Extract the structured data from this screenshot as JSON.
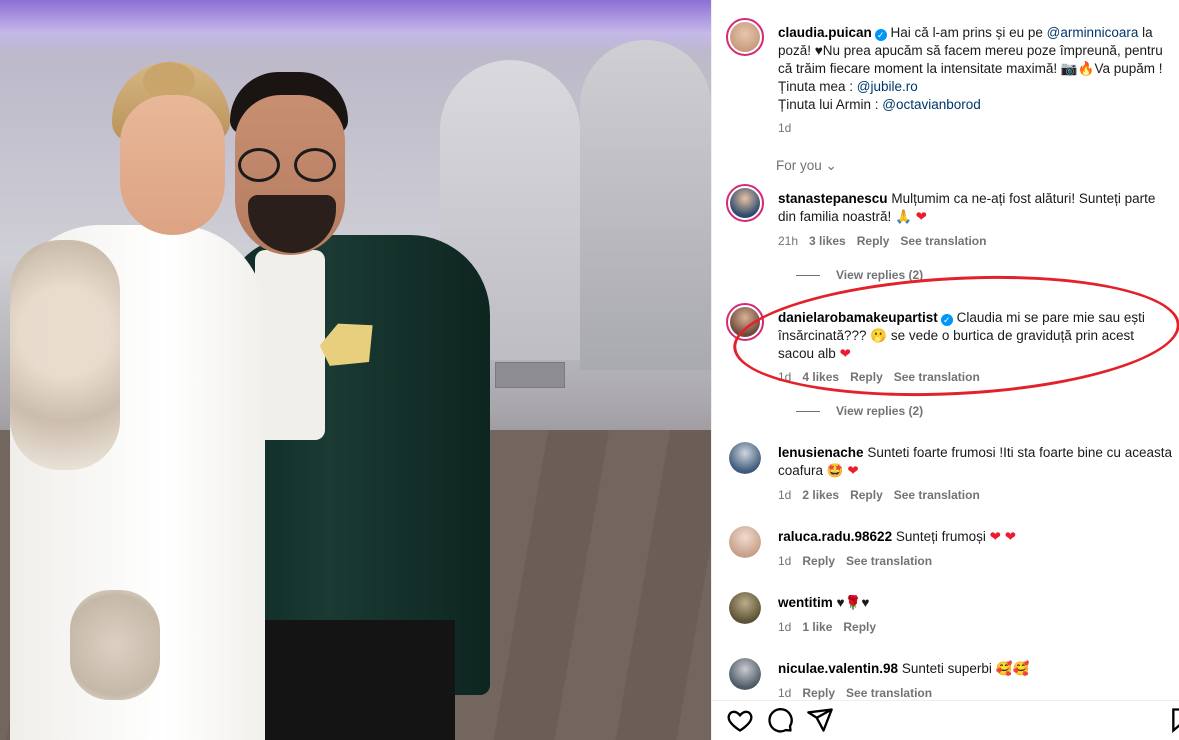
{
  "post": {
    "author": "claudia.puican",
    "caption_parts": {
      "p1": "Hai că l-am prins și eu pe ",
      "mention1": "@arminnicoara",
      "p2": " la poză! ♥Nu prea apucăm să facem mereu poze împreună, pentru că trăim fiecare moment la intensitate maximă! 📷🔥Va pupăm !",
      "outfit1_label": "Ținuta mea : ",
      "mention2": "@jubile.ro",
      "outfit2_label": "Ținuta lui Armin : ",
      "mention3": "@octavianborod"
    },
    "time": "1d"
  },
  "sort_label": "For you",
  "comments": [
    {
      "user": "stanastepanescu",
      "text": "Mulțumim ca ne-ați fost alături! Sunteți parte din familia noastră! 🙏",
      "time": "21h",
      "likes": "3 likes",
      "reply": "Reply",
      "translate": "See translation",
      "view_replies": "View replies (2)",
      "avatar_color": "#2c4a6e"
    },
    {
      "user": "danielarobamakeupartist",
      "text": "Claudia mi se pare mie sau ești însărcinată??? 🫢 se vede o burtica de graviduță prin acest sacou alb",
      "time": "1d",
      "likes": "4 likes",
      "reply": "Reply",
      "translate": "See translation",
      "view_replies": "View replies (2)",
      "avatar_color": "#6b4a3a"
    },
    {
      "user": "lenusienache",
      "text": "Sunteti foarte frumosi !Iti sta foarte bine cu aceasta coafura 🤩",
      "time": "1d",
      "likes": "2 likes",
      "reply": "Reply",
      "translate": "See translation",
      "avatar_color": "#3c5a7a"
    },
    {
      "user": "raluca.radu.98622",
      "text": "Sunteți frumoși",
      "time": "1d",
      "reply": "Reply",
      "translate": "See translation",
      "avatar_color": "#c7a08a"
    },
    {
      "user": "wentitim",
      "text": "♥🌹♥",
      "time": "1d",
      "likes": "1 like",
      "reply": "Reply",
      "avatar_color": "#8a7a55"
    },
    {
      "user": "niculae.valentin.98",
      "text": "Sunteti superbi 🥰🥰",
      "time": "1d",
      "reply": "Reply",
      "translate": "See translation",
      "avatar_color": "#4d5a66"
    }
  ],
  "icons": {
    "like": "heart-outline-icon",
    "comment": "comment-icon",
    "share": "share-icon",
    "save": "bookmark-icon"
  },
  "colors": {
    "mention": "#00376b",
    "verified": "#0095f6",
    "annotation": "#e3212a"
  }
}
